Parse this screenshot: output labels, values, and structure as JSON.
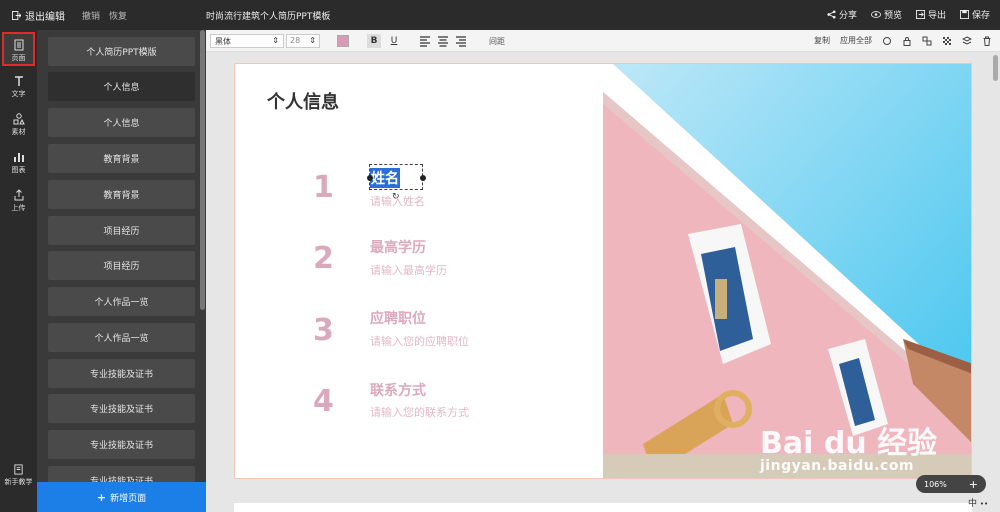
{
  "topbar": {
    "exit_label": "退出编辑",
    "undo_label": "撤销",
    "redo_label": "恢复",
    "doc_title": "时尚流行建筑个人简历PPT模板",
    "share_label": "分享",
    "preview_label": "预览",
    "export_label": "导出",
    "save_label": "保存"
  },
  "leftbar": {
    "items": [
      {
        "label": "页面",
        "icon": "page-icon"
      },
      {
        "label": "文字",
        "icon": "text-icon"
      },
      {
        "label": "素材",
        "icon": "shapes-icon"
      },
      {
        "label": "图表",
        "icon": "chart-icon"
      },
      {
        "label": "上传",
        "icon": "upload-icon"
      }
    ],
    "help_label": "新手教学"
  },
  "pagelist": {
    "items": [
      "个人简历PPT模版",
      "个人信息",
      "个人信息",
      "教育背景",
      "教育背景",
      "项目经历",
      "项目经历",
      "个人作品一览",
      "个人作品一览",
      "专业技能及证书",
      "专业技能及证书",
      "专业技能及证书",
      "专业技能及证书"
    ],
    "active_index": 1,
    "new_page_label": "新增页面"
  },
  "toolbar": {
    "font_name": "黑体",
    "font_size": "28",
    "text_color": "#d99ab5",
    "bold_label": "B",
    "underline_label": "U",
    "spacing_label": "间距",
    "copy_label": "复制",
    "apply_all_label": "应用全部"
  },
  "slide": {
    "title": "个人信息",
    "items": [
      {
        "num": "1",
        "label": "姓名",
        "hint": "请输入姓名"
      },
      {
        "num": "2",
        "label": "最高学历",
        "hint": "请输入最高学历"
      },
      {
        "num": "3",
        "label": "应聘职位",
        "hint": "请输入您的应聘职位"
      },
      {
        "num": "4",
        "label": "联系方式",
        "hint": "请输入您的联系方式"
      }
    ]
  },
  "zoom": {
    "level": "106%",
    "plus": "+"
  },
  "ime_label": "中",
  "watermark": {
    "main": "Bai du 经验",
    "sub": "jingyan.baidu.com"
  },
  "colors": {
    "accent_pink": "#dba9bd",
    "brand_blue": "#1c7fe8",
    "highlight": "#e02b2b"
  }
}
